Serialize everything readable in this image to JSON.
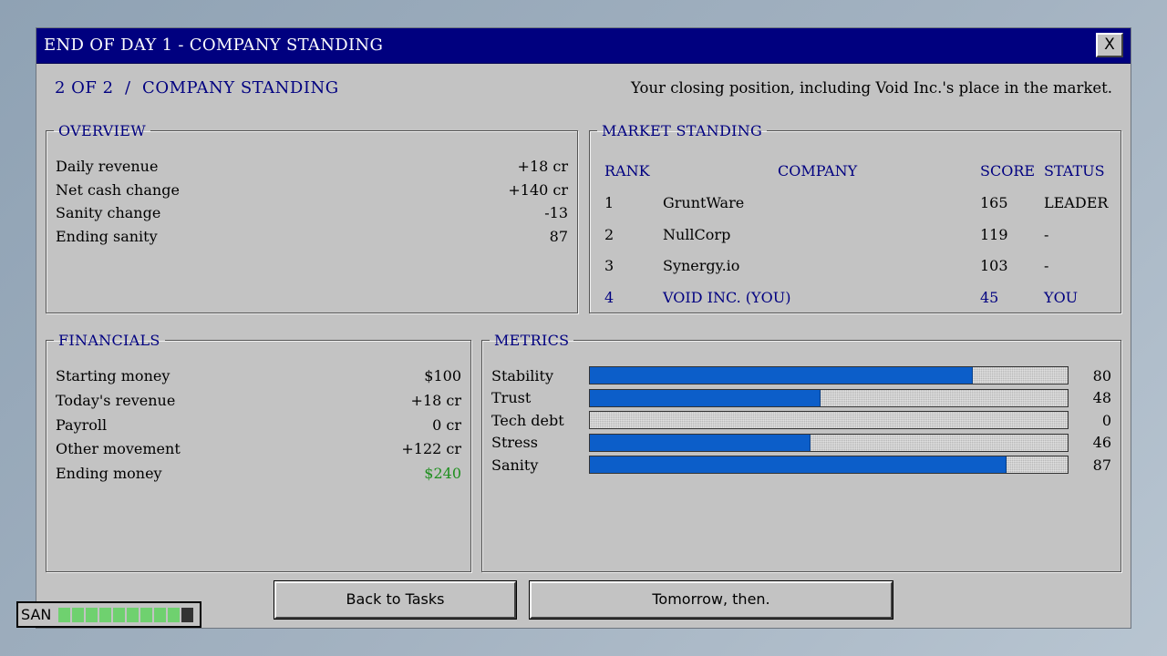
{
  "window": {
    "title": "END OF DAY 1 - COMPANY STANDING",
    "close_label": "X"
  },
  "header": {
    "page_indicator": "2 OF 2  /  COMPANY STANDING",
    "subtitle": "Your closing position, including Void Inc.'s place in the market."
  },
  "overview": {
    "legend": "OVERVIEW",
    "rows": [
      {
        "label": "Daily revenue",
        "value": "+18 cr"
      },
      {
        "label": "Net cash change",
        "value": "+140 cr"
      },
      {
        "label": "Sanity change",
        "value": "-13"
      },
      {
        "label": "Ending sanity",
        "value": "87"
      }
    ]
  },
  "market": {
    "legend": "MARKET STANDING",
    "headers": {
      "rank": "RANK",
      "company": "COMPANY",
      "score": "SCORE",
      "status": "STATUS"
    },
    "rows": [
      {
        "rank": "1",
        "company": "GruntWare",
        "score": "165",
        "status": "LEADER"
      },
      {
        "rank": "2",
        "company": "NullCorp",
        "score": "119",
        "status": "-"
      },
      {
        "rank": "3",
        "company": "Synergy.io",
        "score": "103",
        "status": "-"
      },
      {
        "rank": "4",
        "company": "VOID INC. (YOU)",
        "score": "45",
        "status": "YOU"
      }
    ]
  },
  "financials": {
    "legend": "FINANCIALS",
    "rows": [
      {
        "label": "Starting money",
        "value": "$100"
      },
      {
        "label": "Today's revenue",
        "value": "+18 cr"
      },
      {
        "label": "Payroll",
        "value": "0 cr"
      },
      {
        "label": "Other movement",
        "value": "+122 cr"
      },
      {
        "label": "Ending money",
        "value": "$240"
      }
    ]
  },
  "metrics": {
    "legend": "METRICS",
    "items": [
      {
        "label": "Stability",
        "value": "80",
        "fill_percent": 80
      },
      {
        "label": "Trust",
        "value": "48",
        "fill_percent": 48
      },
      {
        "label": "Tech debt",
        "value": "0",
        "fill_percent": 0
      },
      {
        "label": "Stress",
        "value": "46",
        "fill_percent": 46
      },
      {
        "label": "Sanity",
        "value": "87",
        "fill_percent": 87
      }
    ],
    "bar_color": "#0c5ec9"
  },
  "buttons": {
    "back_label": "Back to Tasks",
    "next_label": "Tomorrow, then."
  },
  "hud": {
    "label": "SAN",
    "segments_on": 9,
    "segments_total": 10,
    "segment_color": "#6fd16f"
  },
  "colors": {
    "titlebar": "#00007f",
    "accent_text": "#000080",
    "positive": "#1f8f1f",
    "window_bg": "#c3c3c3"
  }
}
